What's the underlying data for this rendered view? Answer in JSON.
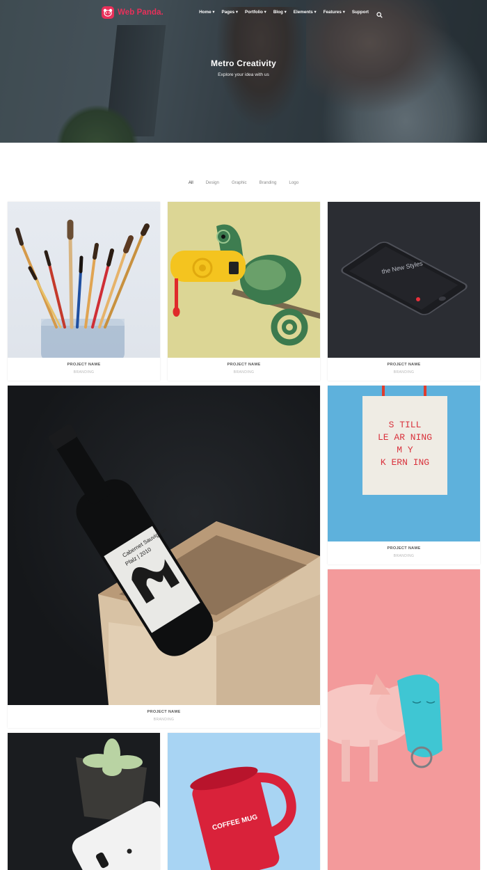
{
  "brand": {
    "name": "Web Panda.",
    "accent": "#e8305a"
  },
  "nav": {
    "items": [
      {
        "label": "Home"
      },
      {
        "label": "Pages"
      },
      {
        "label": "Portfolio"
      },
      {
        "label": "Blog"
      },
      {
        "label": "Elements"
      },
      {
        "label": "Features"
      },
      {
        "label": "Support"
      }
    ],
    "search_icon": "search-icon",
    "dropdown_marker": "▾"
  },
  "hero": {
    "title": "Metro Creativity",
    "subtitle": "Explore your idea with us"
  },
  "filters": {
    "items": [
      "All",
      "Design",
      "Graphic",
      "Branding",
      "Logo"
    ],
    "active": "All"
  },
  "cards": [
    {
      "name": "PROJECT NAME",
      "category": "BRANDING",
      "image": "paint-brushes-in-jar"
    },
    {
      "name": "PROJECT NAME",
      "category": "BRANDING",
      "image": "chameleon-on-yellow"
    },
    {
      "name": "PROJECT NAME",
      "category": "BRANDING",
      "image": "phone-mockup-dark"
    },
    {
      "name": "PROJECT NAME",
      "category": "BRANDING",
      "image": "wine-bottle-in-box"
    },
    {
      "name": "PROJECT NAME",
      "category": "BRANDING",
      "image": "tote-bag-on-blue"
    },
    {
      "name": "",
      "category": "",
      "image": "pig-with-mask-on-pink"
    },
    {
      "name": "",
      "category": "",
      "image": "succulent-and-phone"
    },
    {
      "name": "",
      "category": "",
      "image": "red-coffee-mug"
    }
  ],
  "artwork_text": {
    "bottle_label": [
      "Cabernet Sauvignon",
      "Pfalz | 2010"
    ],
    "bag_text": [
      "S TILL",
      "LE AR NING",
      "M Y",
      "K ERN ING"
    ],
    "phone_text": "the New Styles",
    "mug_text": "COFFEE MUG"
  },
  "colors": {
    "hero_overlay": "#263238",
    "chameleon_bg": "#dcd695",
    "bag_bg": "#5eb1dc",
    "pig_bg": "#f39a9b",
    "mug_bg": "#a8d4f3",
    "mug_red": "#d9223a",
    "bag_text_red": "#d9323c"
  }
}
